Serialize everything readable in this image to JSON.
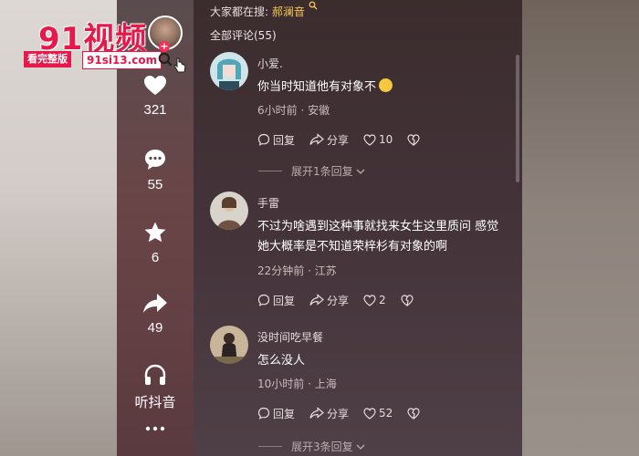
{
  "logo": {
    "big": "91视频",
    "tag": "看完整版",
    "url": "91si13.com"
  },
  "actions": [
    {
      "icon": "heart-icon",
      "count": "321"
    },
    {
      "icon": "comment-bubble-icon",
      "count": "55"
    },
    {
      "icon": "star-icon",
      "count": "6"
    },
    {
      "icon": "share-arrow-icon",
      "count": "49"
    },
    {
      "icon": "headphones-icon",
      "count": "听抖音"
    },
    {
      "icon": "more-dots-icon",
      "count": "..."
    }
  ],
  "panel": {
    "search_hint_prefix": "大家都在搜:",
    "search_hint_keyword": "郝澜音",
    "comments_title": "全部评论(55)"
  },
  "comments": [
    {
      "user": "小爱.",
      "text": "你当时知道他有对象不",
      "meta": "6小时前 · 安徽",
      "reply": "回复",
      "share": "分享",
      "likes": "10",
      "expand": "展开1条回复"
    },
    {
      "user": "手雷",
      "text": "不过为啥遇到这种事就找来女生这里质问 感觉她大概率是不知道荣梓杉有对象的啊",
      "meta": "22分钟前 · 江苏",
      "reply": "回复",
      "share": "分享",
      "likes": "2"
    },
    {
      "user": "没时间吃早餐",
      "text": "怎么没人",
      "meta": "10小时前 · 上海",
      "reply": "回复",
      "share": "分享",
      "likes": "52",
      "expand": "展开3条回复"
    }
  ],
  "colors": {
    "brand_red": "#e6194b",
    "keyword_yellow": "#f2c45a",
    "panel_bg": "#3b2c2e"
  }
}
